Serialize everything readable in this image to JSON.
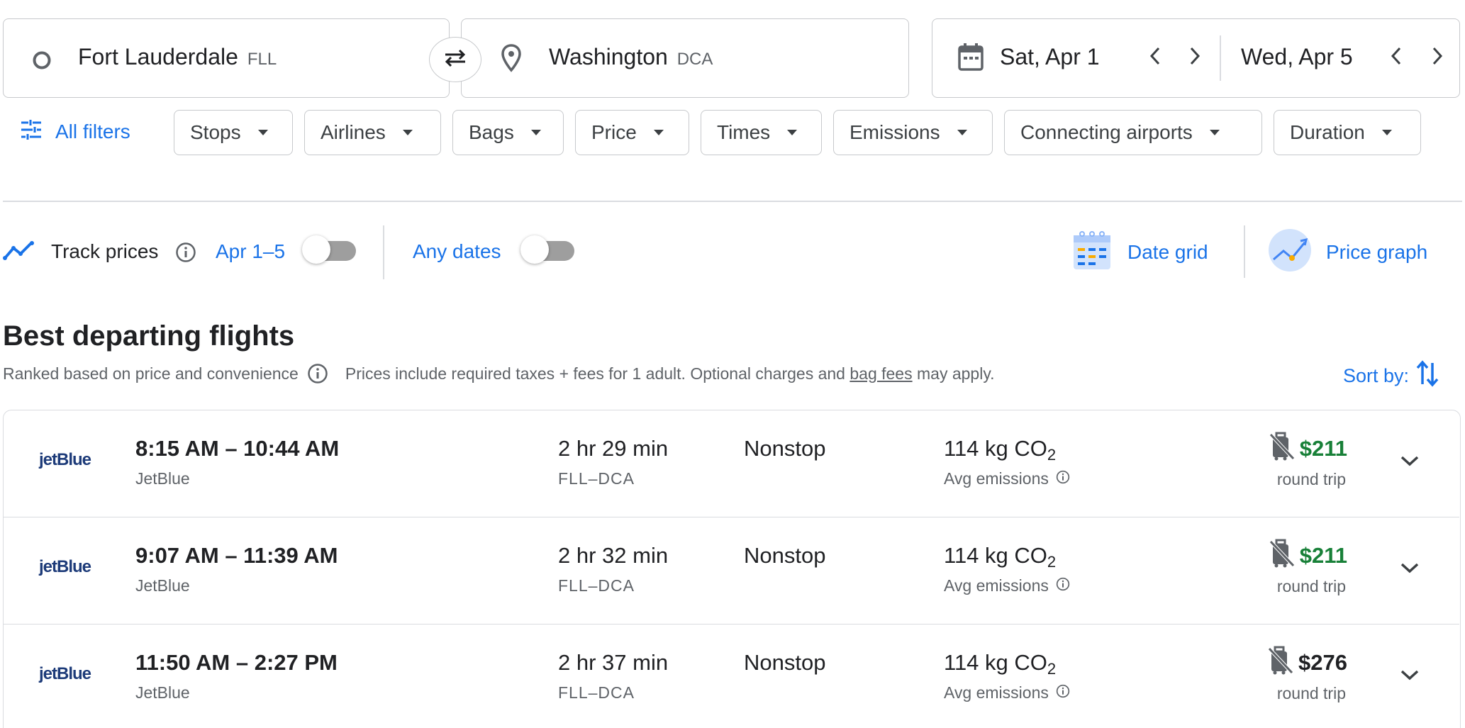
{
  "search": {
    "origin": {
      "city": "Fort Lauderdale",
      "code": "FLL"
    },
    "destination": {
      "city": "Washington",
      "code": "DCA"
    },
    "depart_date": "Sat, Apr 1",
    "return_date": "Wed, Apr 5"
  },
  "filters": {
    "all_filters_label": "All filters",
    "chips": [
      "Stops",
      "Airlines",
      "Bags",
      "Price",
      "Times",
      "Emissions",
      "Connecting airports",
      "Duration"
    ]
  },
  "tracking": {
    "track_label": "Track prices",
    "track_range": "Apr 1–5",
    "track_enabled": false,
    "any_dates_label": "Any dates",
    "any_dates_enabled": false,
    "date_grid_label": "Date grid",
    "price_graph_label": "Price graph"
  },
  "results": {
    "title": "Best departing flights",
    "ranked_text": "Ranked based on price and convenience",
    "prices_text_before": "Prices include required taxes + fees for 1 adult. Optional charges and ",
    "bag_fees_link": "bag fees",
    "prices_text_after": " may apply.",
    "sort_label": "Sort by:",
    "flights": [
      {
        "logo": "jetBlue",
        "times": "8:15 AM – 10:44 AM",
        "airline": "JetBlue",
        "duration": "2 hr 29 min",
        "route": "FLL–DCA",
        "stops": "Nonstop",
        "co2_value": "114 kg CO",
        "co2_sub": "2",
        "emissions_label": "Avg emissions",
        "price": "$211",
        "price_color": "#188038",
        "price_note": "round trip"
      },
      {
        "logo": "jetBlue",
        "times": "9:07 AM – 11:39 AM",
        "airline": "JetBlue",
        "duration": "2 hr 32 min",
        "route": "FLL–DCA",
        "stops": "Nonstop",
        "co2_value": "114 kg CO",
        "co2_sub": "2",
        "emissions_label": "Avg emissions",
        "price": "$211",
        "price_color": "#188038",
        "price_note": "round trip"
      },
      {
        "logo": "jetBlue",
        "times": "11:50 AM – 2:27 PM",
        "airline": "JetBlue",
        "duration": "2 hr 37 min",
        "route": "FLL–DCA",
        "stops": "Nonstop",
        "co2_value": "114 kg CO",
        "co2_sub": "2",
        "emissions_label": "Avg emissions",
        "price": "$276",
        "price_color": "#202124",
        "price_note": "round trip"
      }
    ]
  },
  "colors": {
    "accent": "#1a73e8",
    "good_price": "#188038",
    "border": "#dadce0"
  },
  "icons": [
    "origin-circle-icon",
    "swap-icon",
    "location-pin-icon",
    "calendar-icon",
    "chevron-left-icon",
    "chevron-right-icon",
    "filter-sliders-icon",
    "trend-icon",
    "info-icon",
    "date-grid-icon",
    "price-graph-icon",
    "sort-icon",
    "no-carry-on-icon",
    "chevron-down-icon"
  ]
}
